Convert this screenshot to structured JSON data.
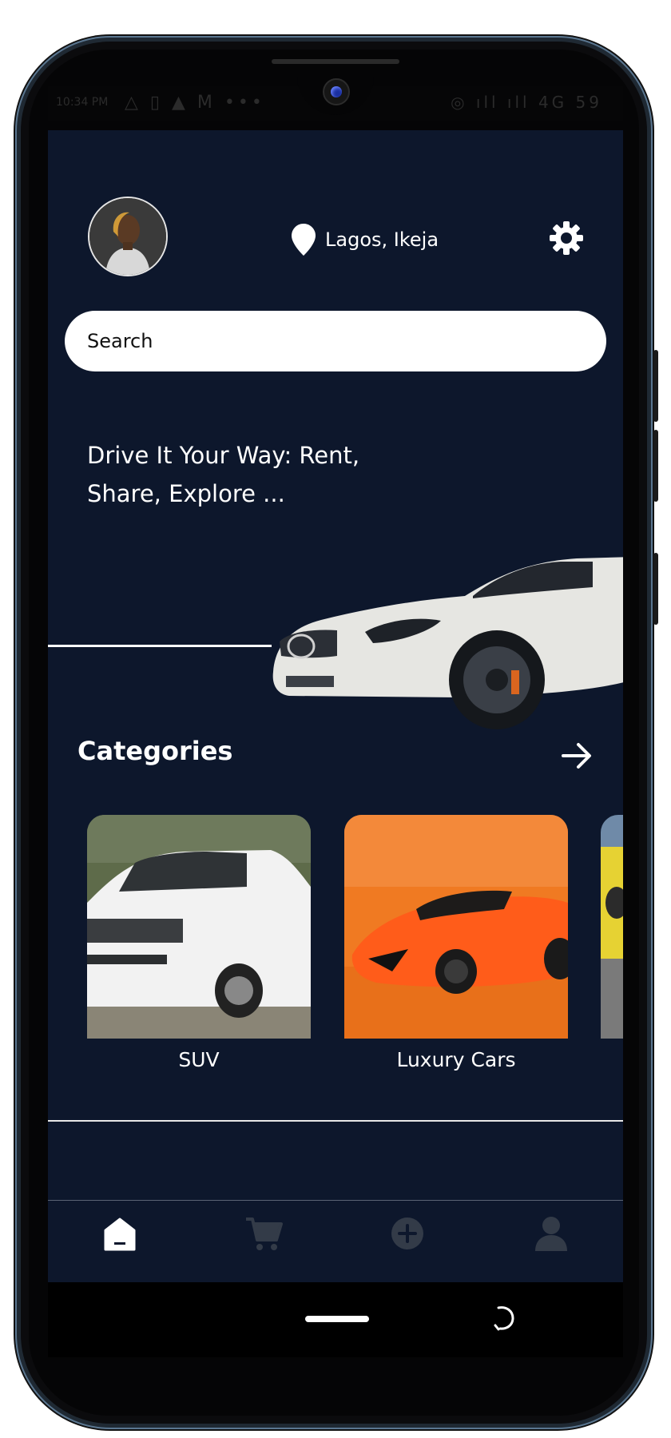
{
  "status_bar": {
    "time": "10:34 PM",
    "left_icons": "△ ▯ ▲ M •••",
    "right_icons": "◎ ıll ıll 4G 59"
  },
  "header": {
    "location": "Lagos, Ikeja",
    "location_icon": "map-pin-icon",
    "settings_icon": "gear-icon",
    "avatar": "user-avatar"
  },
  "search": {
    "placeholder": "Search"
  },
  "hero": {
    "tagline": "Drive It Your Way: Rent, Share, Explore ..."
  },
  "categories": {
    "title": "Categories",
    "items": [
      {
        "label": "SUV"
      },
      {
        "label": "Luxury Cars"
      }
    ]
  },
  "bottom_nav": {
    "items": [
      {
        "name": "home",
        "icon": "home-icon",
        "active": true
      },
      {
        "name": "cart",
        "icon": "cart-icon",
        "active": false
      },
      {
        "name": "add",
        "icon": "plus-circle-icon",
        "active": false
      },
      {
        "name": "profile",
        "icon": "user-icon",
        "active": false
      }
    ]
  },
  "colors": {
    "screen_bg": "#0d172c",
    "text": "#ffffff",
    "inactive_icon": "#333b48"
  }
}
